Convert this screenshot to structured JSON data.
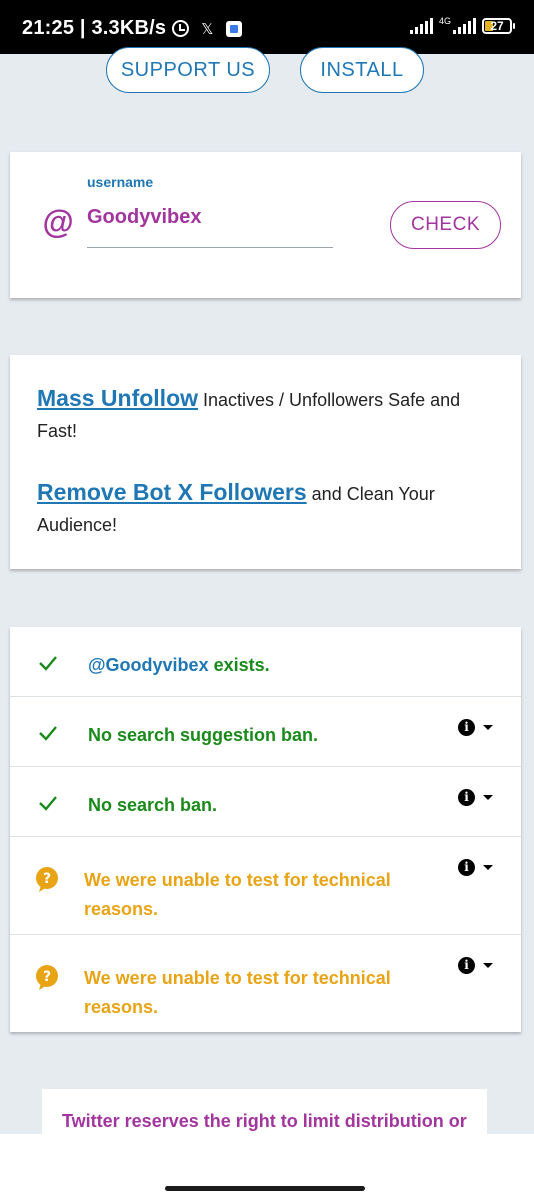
{
  "status_bar": {
    "time_speed": "21:25 | 3.3KB/s",
    "x_logo": "𝕏",
    "network": "4G",
    "battery": "27"
  },
  "top_buttons": {
    "support": "SUPPORT US",
    "install": "INSTALL"
  },
  "username_form": {
    "at_symbol": "@",
    "label": "username",
    "value": "Goodyvibex",
    "check_button": "CHECK"
  },
  "promos": [
    {
      "link": "Mass Unfollow",
      "text": " Inactives / Unfollowers Safe and Fast!"
    },
    {
      "link": "Remove Bot X Followers",
      "text": " and Clean Your Audience!"
    }
  ],
  "results": {
    "row1": {
      "handle": "@Goodyvibex",
      "text": " exists."
    },
    "row2": {
      "text": "No search suggestion ban."
    },
    "row3": {
      "text": "No search ban."
    },
    "row4": {
      "text": "We were unable to test for technical reasons."
    },
    "row5": {
      "text": "We were unable to test for technical reasons."
    }
  },
  "notice": {
    "text": "Twitter reserves the right to limit distribution or"
  },
  "colors": {
    "brand_blue": "#1f77b4",
    "brand_purple": "#a2359e",
    "success_green": "#1a8a1a",
    "warning_orange": "#e8a415"
  }
}
